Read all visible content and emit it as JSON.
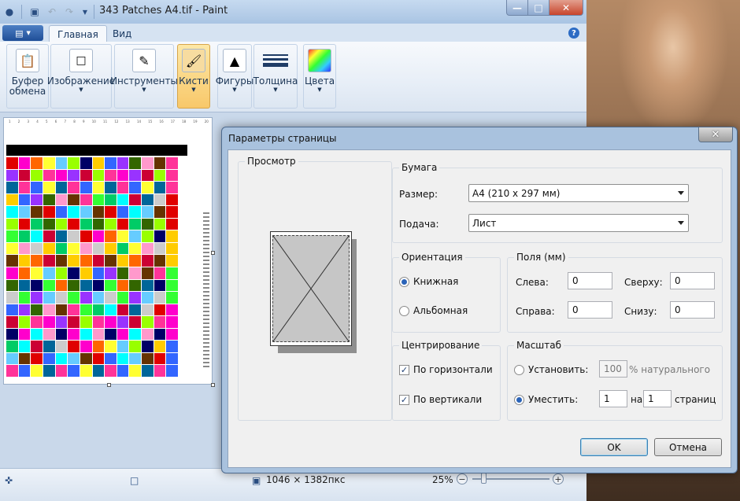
{
  "window": {
    "title": "343 Patches A4.tif - Paint"
  },
  "ribbon": {
    "app_menu_icon": "paint-menu-icon",
    "tabs": [
      {
        "label": "Главная",
        "active": true
      },
      {
        "label": "Вид",
        "active": false
      }
    ],
    "groups": [
      {
        "line1": "Буфер",
        "line2": "обмена",
        "icon": "clipboard-icon"
      },
      {
        "line1": "Изображение",
        "line2": "",
        "icon": "select-icon"
      },
      {
        "line1": "Инструменты",
        "line2": "",
        "icon": "tools-icon"
      },
      {
        "line1": "Кисти",
        "line2": "",
        "icon": "brush-icon",
        "active": true
      },
      {
        "line1": "Фигуры",
        "line2": "",
        "icon": "shapes-icon"
      },
      {
        "line1": "Толщина",
        "line2": "",
        "icon": "thickness-icon"
      },
      {
        "line1": "Цвета",
        "line2": "",
        "icon": "colors-icon"
      }
    ]
  },
  "canvas": {
    "ruler": [
      "1",
      "2",
      "3",
      "4",
      "5",
      "6",
      "7",
      "8",
      "9",
      "10",
      "11",
      "12",
      "13",
      "14",
      "15",
      "16",
      "17",
      "18",
      "19",
      "20"
    ],
    "palette": [
      "#e00000",
      "#ffcc00",
      "#33ff33",
      "#ff00cc",
      "#3366ff",
      "#00cc66",
      "#ff6600",
      "#9933ff",
      "#00ffff",
      "#ffff33",
      "#336600",
      "#cc0033",
      "#66ccff",
      "#ff99cc",
      "#006699",
      "#99ff00",
      "#663300",
      "#cccccc",
      "#000066",
      "#ff3399"
    ]
  },
  "statusbar": {
    "dimensions": "1046 × 1382пкс",
    "zoom": "25%"
  },
  "dialog": {
    "title": "Параметры страницы",
    "preview": {
      "title": "Просмотр"
    },
    "paper": {
      "title": "Бумага",
      "size_label": "Размер:",
      "size_value": "A4 (210 x 297 мм)",
      "source_label": "Подача:",
      "source_value": "Лист"
    },
    "orientation": {
      "title": "Ориентация",
      "portrait": "Книжная",
      "landscape": "Альбомная",
      "selected": "portrait"
    },
    "margins": {
      "title": "Поля (мм)",
      "left_label": "Слева:",
      "left": "0",
      "top_label": "Сверху:",
      "top": "0",
      "right_label": "Справа:",
      "right": "0",
      "bottom_label": "Снизу:",
      "bottom": "0"
    },
    "centering": {
      "title": "Центрирование",
      "horizontal": "По горизонтали",
      "vertical": "По вертикали",
      "horizontal_checked": true,
      "vertical_checked": true
    },
    "scale": {
      "title": "Масштаб",
      "adjust_label": "Установить:",
      "adjust_value": "100",
      "adjust_suffix": "% натурального",
      "fit_label": "Уместить:",
      "fit_wide": "1",
      "fit_by": "на",
      "fit_tall": "1",
      "fit_suffix": "страниц",
      "selected": "fit"
    },
    "ok_label": "OK",
    "cancel_label": "Отмена"
  }
}
